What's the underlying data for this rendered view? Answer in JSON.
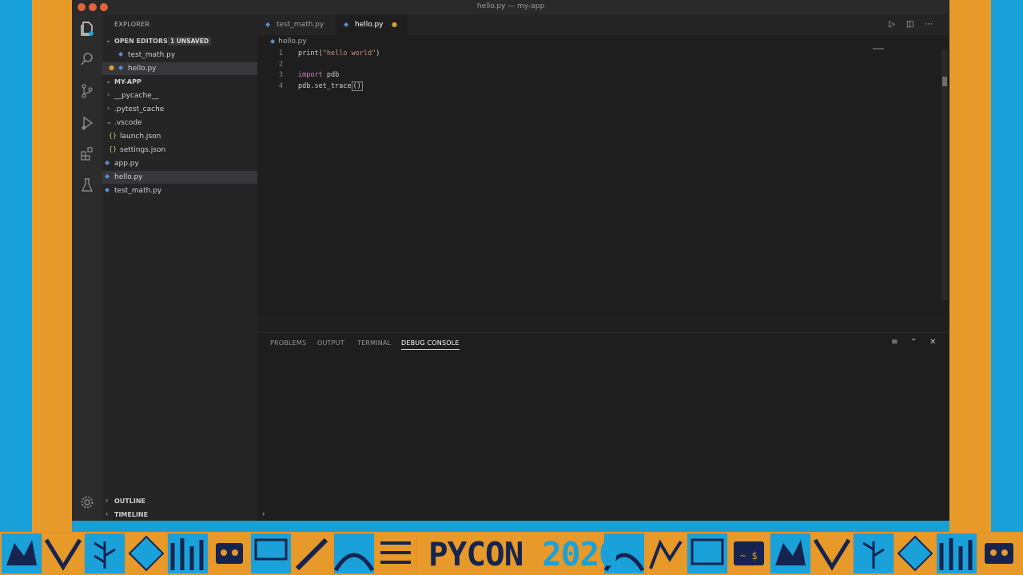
{
  "window": {
    "title": "hello.py — my-app"
  },
  "sidebar": {
    "header": "EXPLORER",
    "open_editors": {
      "label": "OPEN EDITORS",
      "badge": "1 UNSAVED",
      "items": [
        {
          "label": "test_math.py"
        },
        {
          "label": "hello.py"
        }
      ]
    },
    "project": {
      "label": "MY-APP",
      "items": [
        {
          "label": "__pycache__",
          "kind": "folder"
        },
        {
          "label": ".pytest_cache",
          "kind": "folder"
        },
        {
          "label": ".vscode",
          "kind": "folder-open"
        },
        {
          "label": "launch.json",
          "kind": "json"
        },
        {
          "label": "settings.json",
          "kind": "json"
        },
        {
          "label": "app.py",
          "kind": "python"
        },
        {
          "label": "hello.py",
          "kind": "python"
        },
        {
          "label": "test_math.py",
          "kind": "python"
        }
      ]
    },
    "outline": "OUTLINE",
    "timeline": "TIMELINE"
  },
  "tabs": [
    {
      "label": "test_math.py",
      "active": false
    },
    {
      "label": "hello.py",
      "active": true,
      "unsaved": true
    }
  ],
  "editor": {
    "breadcrumb": "hello.py",
    "lines": [
      {
        "num": "1",
        "kw": "",
        "before": "print(",
        "str": "\"hello world\"",
        "after": ")"
      },
      {
        "num": "2",
        "kw": "",
        "before": "",
        "str": "",
        "after": ""
      },
      {
        "num": "3",
        "kw": "import",
        "before": " pdb",
        "str": "",
        "after": ""
      },
      {
        "num": "4",
        "kw": "",
        "before": "pdb.set_trace",
        "str": "",
        "after": "()"
      }
    ]
  },
  "panel": {
    "tabs": [
      "PROBLEMS",
      "OUTPUT",
      "TERMINAL",
      "DEBUG CONSOLE"
    ],
    "active_tab": "DEBUG CONSOLE",
    "prompt": "›"
  },
  "footer": {
    "title_a": "PYCON",
    "title_b": "2020"
  },
  "colors": {
    "brand_blue": "#1aa1d9",
    "brand_gold": "#e79a29",
    "brand_navy": "#16244f",
    "status_bar": "#1a9fd4"
  }
}
